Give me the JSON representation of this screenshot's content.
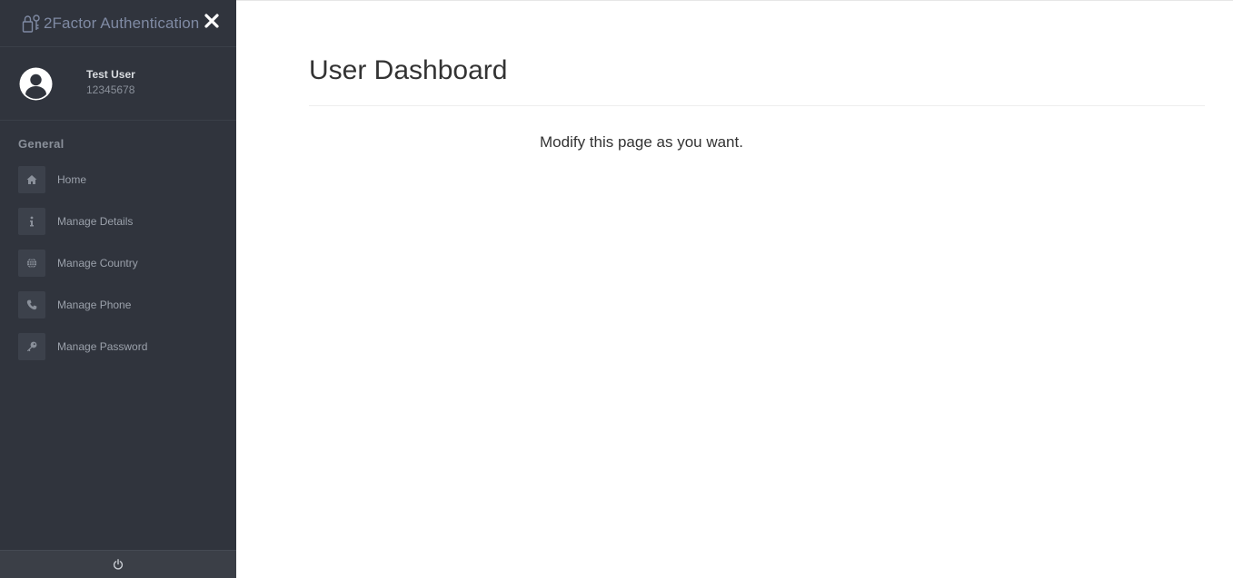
{
  "brand": {
    "title": "2Factor Authentication",
    "icon": "lock-key-icon",
    "close_icon": "close-icon"
  },
  "profile": {
    "name": "Test User",
    "id": "12345678",
    "icon": "user-circle-icon"
  },
  "sidebar": {
    "section_title": "General",
    "items": [
      {
        "label": "Home",
        "icon": "home-icon"
      },
      {
        "label": "Manage Details",
        "icon": "info-icon"
      },
      {
        "label": "Manage Country",
        "icon": "globe-icon"
      },
      {
        "label": "Manage Phone",
        "icon": "phone-icon"
      },
      {
        "label": "Manage Password",
        "icon": "key-icon"
      }
    ],
    "footer_icon": "power-icon"
  },
  "main": {
    "title": "User Dashboard",
    "text": "Modify this page as you want."
  },
  "colors": {
    "sidebar_bg": "#30343d",
    "brand_text": "#7f8aa3",
    "menu_icon_bg": "#3c414b"
  }
}
